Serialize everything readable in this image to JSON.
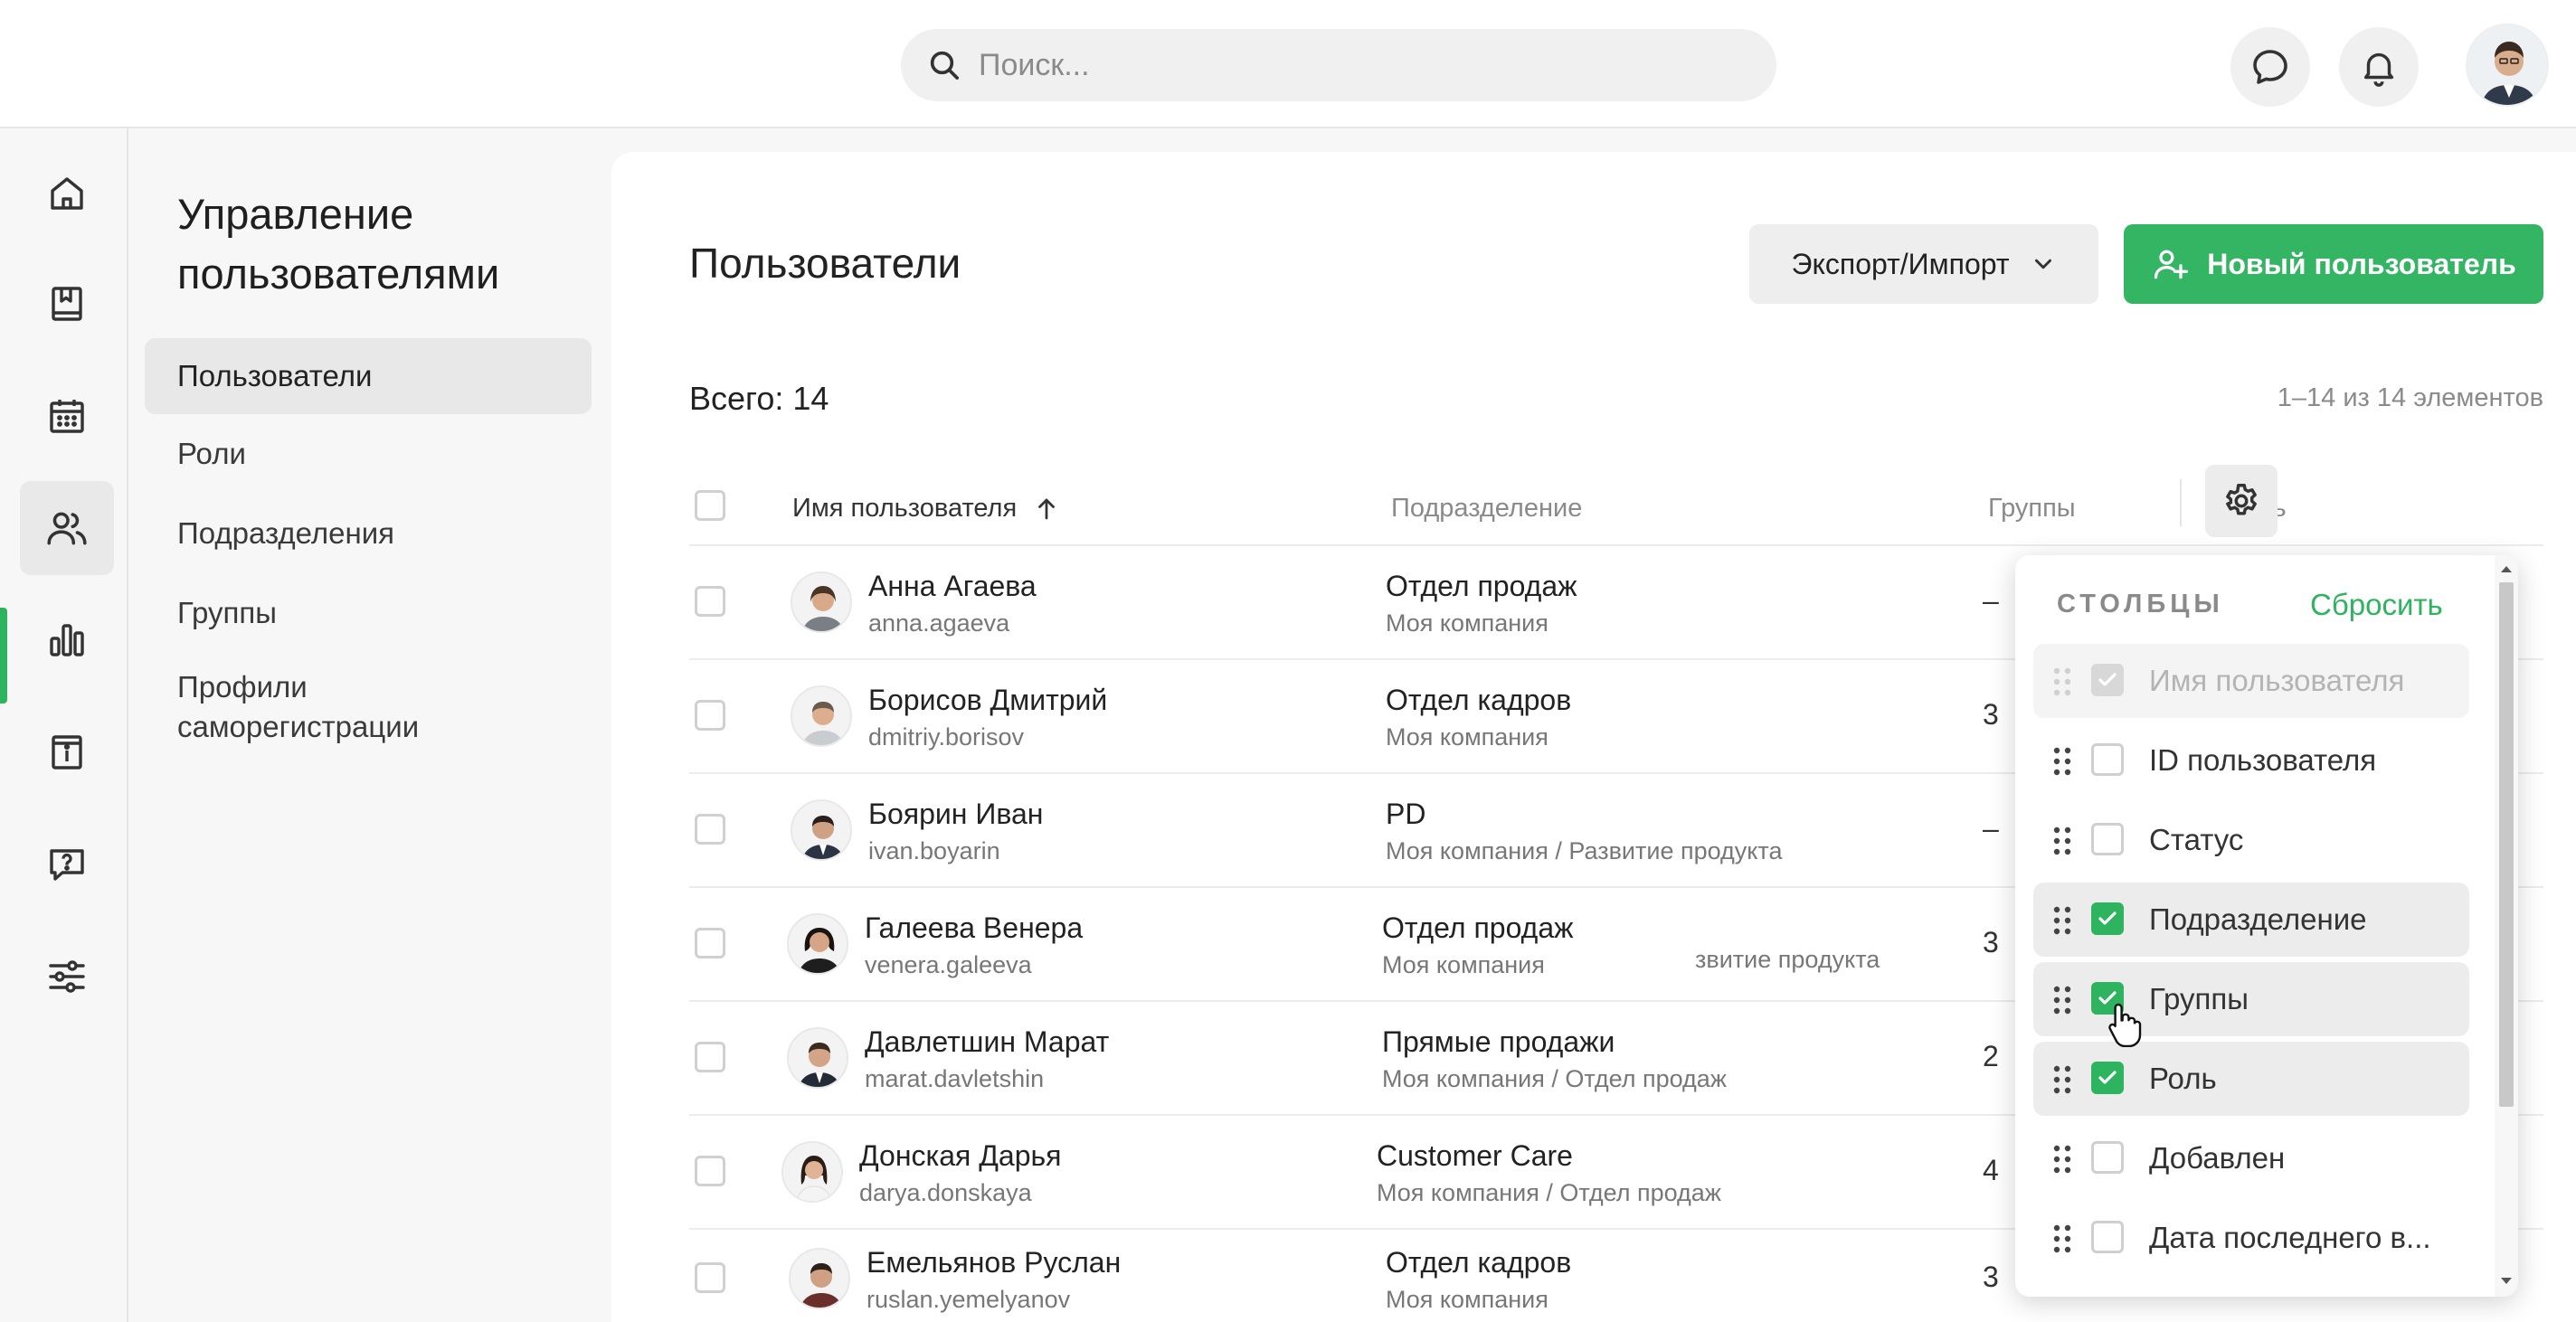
{
  "topbar": {
    "search_placeholder": "Поиск...",
    "icons": [
      "search-icon",
      "chat-icon",
      "bell-icon",
      "avatar"
    ]
  },
  "rail": {
    "items": [
      "home-icon",
      "book-icon",
      "calendar-icon",
      "users-icon",
      "bar-chart-icon",
      "info-book-icon",
      "help-icon",
      "sliders-icon"
    ],
    "active": "users-icon",
    "accent": "#2eb35f"
  },
  "subnav": {
    "title_line1": "Управление",
    "title_line2": "пользователями",
    "items": [
      {
        "label": "Пользователи"
      },
      {
        "label": "Роли"
      },
      {
        "label": "Подразделения"
      },
      {
        "label": "Группы"
      },
      {
        "label_line1": "Профили",
        "label_line2": "саморегистрации"
      }
    ]
  },
  "main": {
    "title": "Пользователи",
    "export_label": "Экспорт/Импорт",
    "new_user_label": "Новый пользователь",
    "total_label": "Всего: 14",
    "range_label": "1–14 из 14 элементов",
    "columns": {
      "name": "Имя пользователя",
      "dept": "Подразделение",
      "groups": "Группы",
      "role": "Роль"
    },
    "rows": [
      {
        "name": "Анна Агаева",
        "login": "anna.agaeva",
        "dept": "Отдел продаж",
        "dept_path": "Моя компания",
        "groups": "–"
      },
      {
        "name": "Борисов Дмитрий",
        "login": "dmitriy.borisov",
        "dept": "Отдел кадров",
        "dept_path": "Моя компания",
        "groups": "3"
      },
      {
        "name": "Боярин Иван",
        "login": "ivan.boyarin",
        "dept": "PD",
        "dept_path": "Моя компания / Развитие продукта",
        "groups": "–"
      },
      {
        "name": "Галеева Венера",
        "login": "venera.galeeva",
        "dept": "Отдел продаж",
        "dept_path": "Моя компания",
        "groups": "3",
        "ghost": "звитие продукта"
      },
      {
        "name": "Давлетшин Марат",
        "login": "marat.davletshin",
        "dept": "Прямые продажи",
        "dept_path": "Моя компания / Отдел продаж",
        "groups": "2"
      },
      {
        "name": "Донская Дарья",
        "login": "darya.donskaya",
        "dept": "Customer Care",
        "dept_path": "Моя компания / Отдел продаж",
        "groups": "4"
      },
      {
        "name": "Емельянов Руслан",
        "login": "ruslan.yemelyanov",
        "dept": "Отдел кадров",
        "dept_path": "Моя компания",
        "groups": "3"
      }
    ]
  },
  "columns_popup": {
    "heading": "СТОЛБЦЫ",
    "reset_label": "Сбросить",
    "items": [
      {
        "label": "Имя пользователя",
        "checked": true,
        "locked": true
      },
      {
        "label": "ID пользователя",
        "checked": false
      },
      {
        "label": "Статус",
        "checked": false
      },
      {
        "label": "Подразделение",
        "checked": true
      },
      {
        "label": "Группы",
        "checked": true
      },
      {
        "label": "Роль",
        "checked": true
      },
      {
        "label": "Добавлен",
        "checked": false
      },
      {
        "label": "Дата последнего в...",
        "checked": false
      }
    ]
  }
}
